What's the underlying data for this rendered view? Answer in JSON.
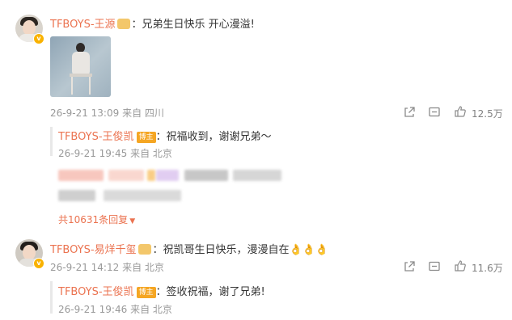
{
  "comments": [
    {
      "author": "TFBOYS-王源",
      "text": "：兄弟生日快乐 开心漫溢!",
      "time": "26-9-21 13:09",
      "location": "来自 四川",
      "likes": "12.5万",
      "reply": {
        "author": "TFBOYS-王俊凯",
        "tag": "博主",
        "text": "：祝福收到，谢谢兄弟～",
        "time": "26-9-21 19:45",
        "location": "来自 北京"
      },
      "more_replies": "共10631条回复"
    },
    {
      "author": "TFBOYS-易烊千玺",
      "text": "：祝凯哥生日快乐，漫漫自在👌👌👌",
      "time": "26-9-21 14:12",
      "location": "来自 北京",
      "likes": "11.6万",
      "reply": {
        "author": "TFBOYS-王俊凯",
        "tag": "博主",
        "text": "：签收祝福，谢了兄弟!",
        "time": "26-9-21 19:46",
        "location": "来自 北京"
      }
    }
  ],
  "colors": {
    "name": "#eb7350",
    "meta": "#999999",
    "verified": "#f9b200"
  },
  "icons": [
    "share-icon",
    "comment-icon",
    "like-icon",
    "verified-badge-icon",
    "crown-icon",
    "chevron-down-icon"
  ]
}
